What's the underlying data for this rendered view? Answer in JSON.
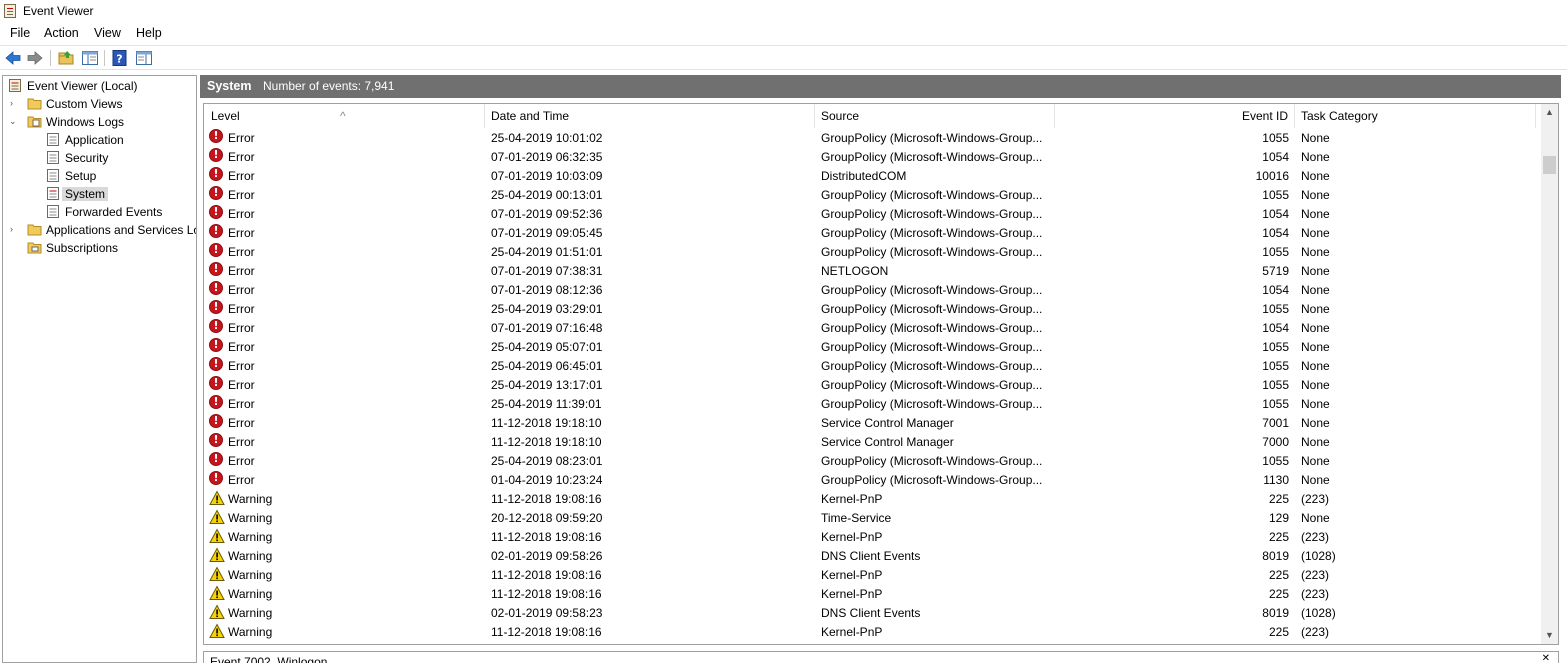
{
  "window": {
    "title": "Event Viewer"
  },
  "menu": [
    "File",
    "Action",
    "View",
    "Help"
  ],
  "toolbar": {
    "icons": [
      "back-arrow-icon",
      "forward-arrow-icon",
      "open-folder-icon",
      "show-hide-tree-icon",
      "help-icon",
      "show-hide-action-pane-icon"
    ]
  },
  "tree": {
    "root": "Event Viewer (Local)",
    "custom_views": "Custom Views",
    "windows_logs": "Windows Logs",
    "application": "Application",
    "security": "Security",
    "setup": "Setup",
    "system": "System",
    "forwarded_events": "Forwarded Events",
    "apps_services": "Applications and Services Lo",
    "subscriptions": "Subscriptions"
  },
  "panel": {
    "title": "System",
    "count_text": "Number of events: 7,941"
  },
  "columns": {
    "level": "Level",
    "datetime": "Date and Time",
    "source": "Source",
    "event_id": "Event ID",
    "task_category": "Task Category"
  },
  "colors": {
    "error": "#c4161c",
    "warning": "#f5d20a",
    "header": "#707070",
    "selection": "#d9d9d9"
  },
  "rows": [
    {
      "level": "Error",
      "datetime": "25-04-2019 10:01:02",
      "source": "GroupPolicy (Microsoft-Windows-Group...",
      "event_id": "1055",
      "task": "None"
    },
    {
      "level": "Error",
      "datetime": "07-01-2019 06:32:35",
      "source": "GroupPolicy (Microsoft-Windows-Group...",
      "event_id": "1054",
      "task": "None"
    },
    {
      "level": "Error",
      "datetime": "07-01-2019 10:03:09",
      "source": "DistributedCOM",
      "event_id": "10016",
      "task": "None"
    },
    {
      "level": "Error",
      "datetime": "25-04-2019 00:13:01",
      "source": "GroupPolicy (Microsoft-Windows-Group...",
      "event_id": "1055",
      "task": "None"
    },
    {
      "level": "Error",
      "datetime": "07-01-2019 09:52:36",
      "source": "GroupPolicy (Microsoft-Windows-Group...",
      "event_id": "1054",
      "task": "None"
    },
    {
      "level": "Error",
      "datetime": "07-01-2019 09:05:45",
      "source": "GroupPolicy (Microsoft-Windows-Group...",
      "event_id": "1054",
      "task": "None"
    },
    {
      "level": "Error",
      "datetime": "25-04-2019 01:51:01",
      "source": "GroupPolicy (Microsoft-Windows-Group...",
      "event_id": "1055",
      "task": "None"
    },
    {
      "level": "Error",
      "datetime": "07-01-2019 07:38:31",
      "source": "NETLOGON",
      "event_id": "5719",
      "task": "None"
    },
    {
      "level": "Error",
      "datetime": "07-01-2019 08:12:36",
      "source": "GroupPolicy (Microsoft-Windows-Group...",
      "event_id": "1054",
      "task": "None"
    },
    {
      "level": "Error",
      "datetime": "25-04-2019 03:29:01",
      "source": "GroupPolicy (Microsoft-Windows-Group...",
      "event_id": "1055",
      "task": "None"
    },
    {
      "level": "Error",
      "datetime": "07-01-2019 07:16:48",
      "source": "GroupPolicy (Microsoft-Windows-Group...",
      "event_id": "1054",
      "task": "None"
    },
    {
      "level": "Error",
      "datetime": "25-04-2019 05:07:01",
      "source": "GroupPolicy (Microsoft-Windows-Group...",
      "event_id": "1055",
      "task": "None"
    },
    {
      "level": "Error",
      "datetime": "25-04-2019 06:45:01",
      "source": "GroupPolicy (Microsoft-Windows-Group...",
      "event_id": "1055",
      "task": "None"
    },
    {
      "level": "Error",
      "datetime": "25-04-2019 13:17:01",
      "source": "GroupPolicy (Microsoft-Windows-Group...",
      "event_id": "1055",
      "task": "None"
    },
    {
      "level": "Error",
      "datetime": "25-04-2019 11:39:01",
      "source": "GroupPolicy (Microsoft-Windows-Group...",
      "event_id": "1055",
      "task": "None"
    },
    {
      "level": "Error",
      "datetime": "11-12-2018 19:18:10",
      "source": "Service Control Manager",
      "event_id": "7001",
      "task": "None"
    },
    {
      "level": "Error",
      "datetime": "11-12-2018 19:18:10",
      "source": "Service Control Manager",
      "event_id": "7000",
      "task": "None"
    },
    {
      "level": "Error",
      "datetime": "25-04-2019 08:23:01",
      "source": "GroupPolicy (Microsoft-Windows-Group...",
      "event_id": "1055",
      "task": "None"
    },
    {
      "level": "Error",
      "datetime": "01-04-2019 10:23:24",
      "source": "GroupPolicy (Microsoft-Windows-Group...",
      "event_id": "1130",
      "task": "None"
    },
    {
      "level": "Warning",
      "datetime": "11-12-2018 19:08:16",
      "source": "Kernel-PnP",
      "event_id": "225",
      "task": "(223)"
    },
    {
      "level": "Warning",
      "datetime": "20-12-2018 09:59:20",
      "source": "Time-Service",
      "event_id": "129",
      "task": "None"
    },
    {
      "level": "Warning",
      "datetime": "11-12-2018 19:08:16",
      "source": "Kernel-PnP",
      "event_id": "225",
      "task": "(223)"
    },
    {
      "level": "Warning",
      "datetime": "02-01-2019 09:58:26",
      "source": "DNS Client Events",
      "event_id": "8019",
      "task": "(1028)"
    },
    {
      "level": "Warning",
      "datetime": "11-12-2018 19:08:16",
      "source": "Kernel-PnP",
      "event_id": "225",
      "task": "(223)"
    },
    {
      "level": "Warning",
      "datetime": "11-12-2018 19:08:16",
      "source": "Kernel-PnP",
      "event_id": "225",
      "task": "(223)"
    },
    {
      "level": "Warning",
      "datetime": "02-01-2019 09:58:23",
      "source": "DNS Client Events",
      "event_id": "8019",
      "task": "(1028)"
    },
    {
      "level": "Warning",
      "datetime": "11-12-2018 19:08:16",
      "source": "Kernel-PnP",
      "event_id": "225",
      "task": "(223)"
    }
  ],
  "detail": {
    "title": "Event 7002, Winlogon"
  }
}
